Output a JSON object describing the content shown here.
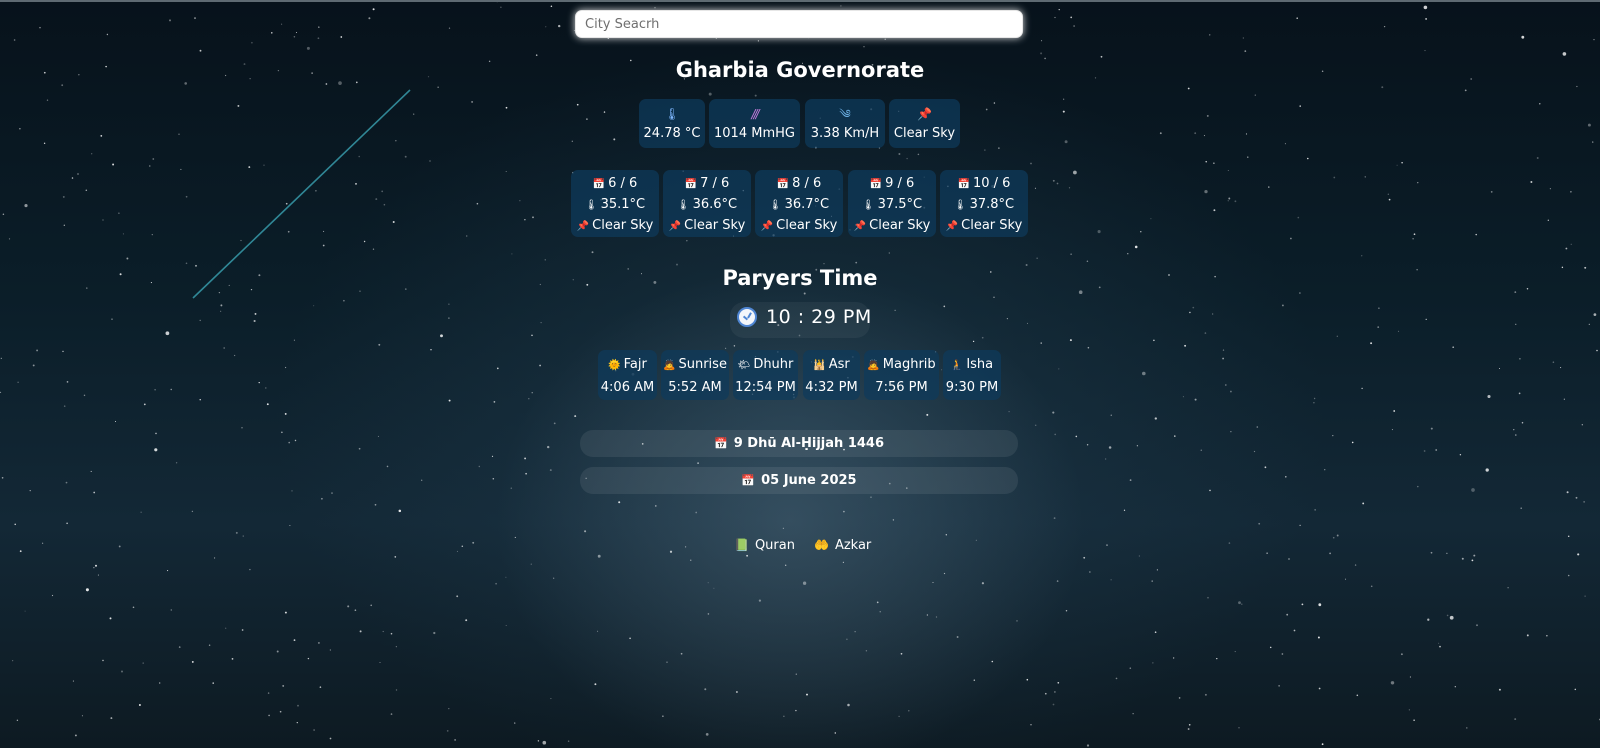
{
  "search": {
    "placeholder": "City Seacrh"
  },
  "city": {
    "name": "Gharbia Governorate"
  },
  "current_weather": [
    {
      "icon": "thermometer-icon",
      "glyph": "🌡",
      "value": "24.78 °C"
    },
    {
      "icon": "pressure-icon",
      "glyph": "///",
      "value": "1014 MmHG"
    },
    {
      "icon": "wind-icon",
      "glyph": "༄",
      "value": "3.38 Km/H"
    },
    {
      "icon": "pin-icon",
      "glyph": "📌",
      "value": "Clear Sky"
    }
  ],
  "forecast": [
    {
      "date": "6 / 6",
      "temp": "35.1°C",
      "desc": "Clear Sky"
    },
    {
      "date": "7 / 6",
      "temp": "36.6°C",
      "desc": "Clear Sky"
    },
    {
      "date": "8 / 6",
      "temp": "36.7°C",
      "desc": "Clear Sky"
    },
    {
      "date": "9 / 6",
      "temp": "37.5°C",
      "desc": "Clear Sky"
    },
    {
      "date": "10 / 6",
      "temp": "37.8°C",
      "desc": "Clear Sky"
    }
  ],
  "forecast_icons": {
    "date": "📅",
    "temp": "🌡",
    "desc": "📌"
  },
  "prayers": {
    "title": "Paryers Time",
    "clock": "10 : 29 PM",
    "items": [
      {
        "icon": "🌞",
        "name": "Fajr",
        "time": "4:06 AM"
      },
      {
        "icon": "🙇",
        "name": "Sunrise",
        "time": "5:52 AM"
      },
      {
        "icon": "🌤",
        "name": "Dhuhr",
        "time": "12:54 PM"
      },
      {
        "icon": "🕌",
        "name": "Asr",
        "time": "4:32 PM"
      },
      {
        "icon": "🙇",
        "name": "Maghrib",
        "time": "7:56 PM"
      },
      {
        "icon": "🧎",
        "name": "Isha",
        "time": "9:30 PM"
      }
    ]
  },
  "dates": {
    "icon": "📅",
    "hijri": "9 Dhū Al-Ḥijjah 1446",
    "gregorian": "05 June 2025"
  },
  "links": [
    {
      "icon": "📗",
      "label": "Quran"
    },
    {
      "icon": "🤲",
      "label": "Azkar"
    }
  ]
}
